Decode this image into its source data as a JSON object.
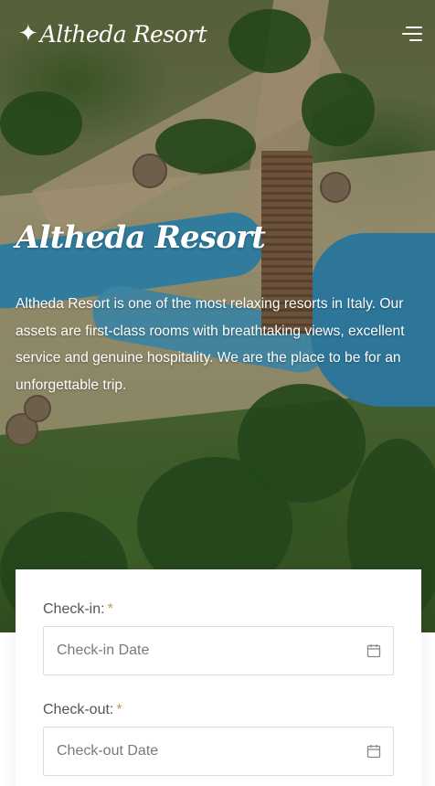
{
  "brand": {
    "icon": "sparkle-icon",
    "name": "Altheda Resort"
  },
  "nav": {
    "menu_icon": "hamburger-menu-icon"
  },
  "hero": {
    "title": "Altheda Resort",
    "description": "Altheda Resort is one of the most relaxing resorts in Italy. Our assets are first-class rooms with breathtaking views, excellent service and genuine hospitality. We are the place to be for an unforgettable trip."
  },
  "booking": {
    "checkin": {
      "label": "Check-in:",
      "required_mark": "*",
      "placeholder": "Check-in Date",
      "icon": "calendar-icon"
    },
    "checkout": {
      "label": "Check-out:",
      "required_mark": "*",
      "placeholder": "Check-out Date",
      "icon": "calendar-icon"
    }
  },
  "colors": {
    "accent": "#c39a5b",
    "text": "#555555",
    "border": "#dcdcdc"
  }
}
